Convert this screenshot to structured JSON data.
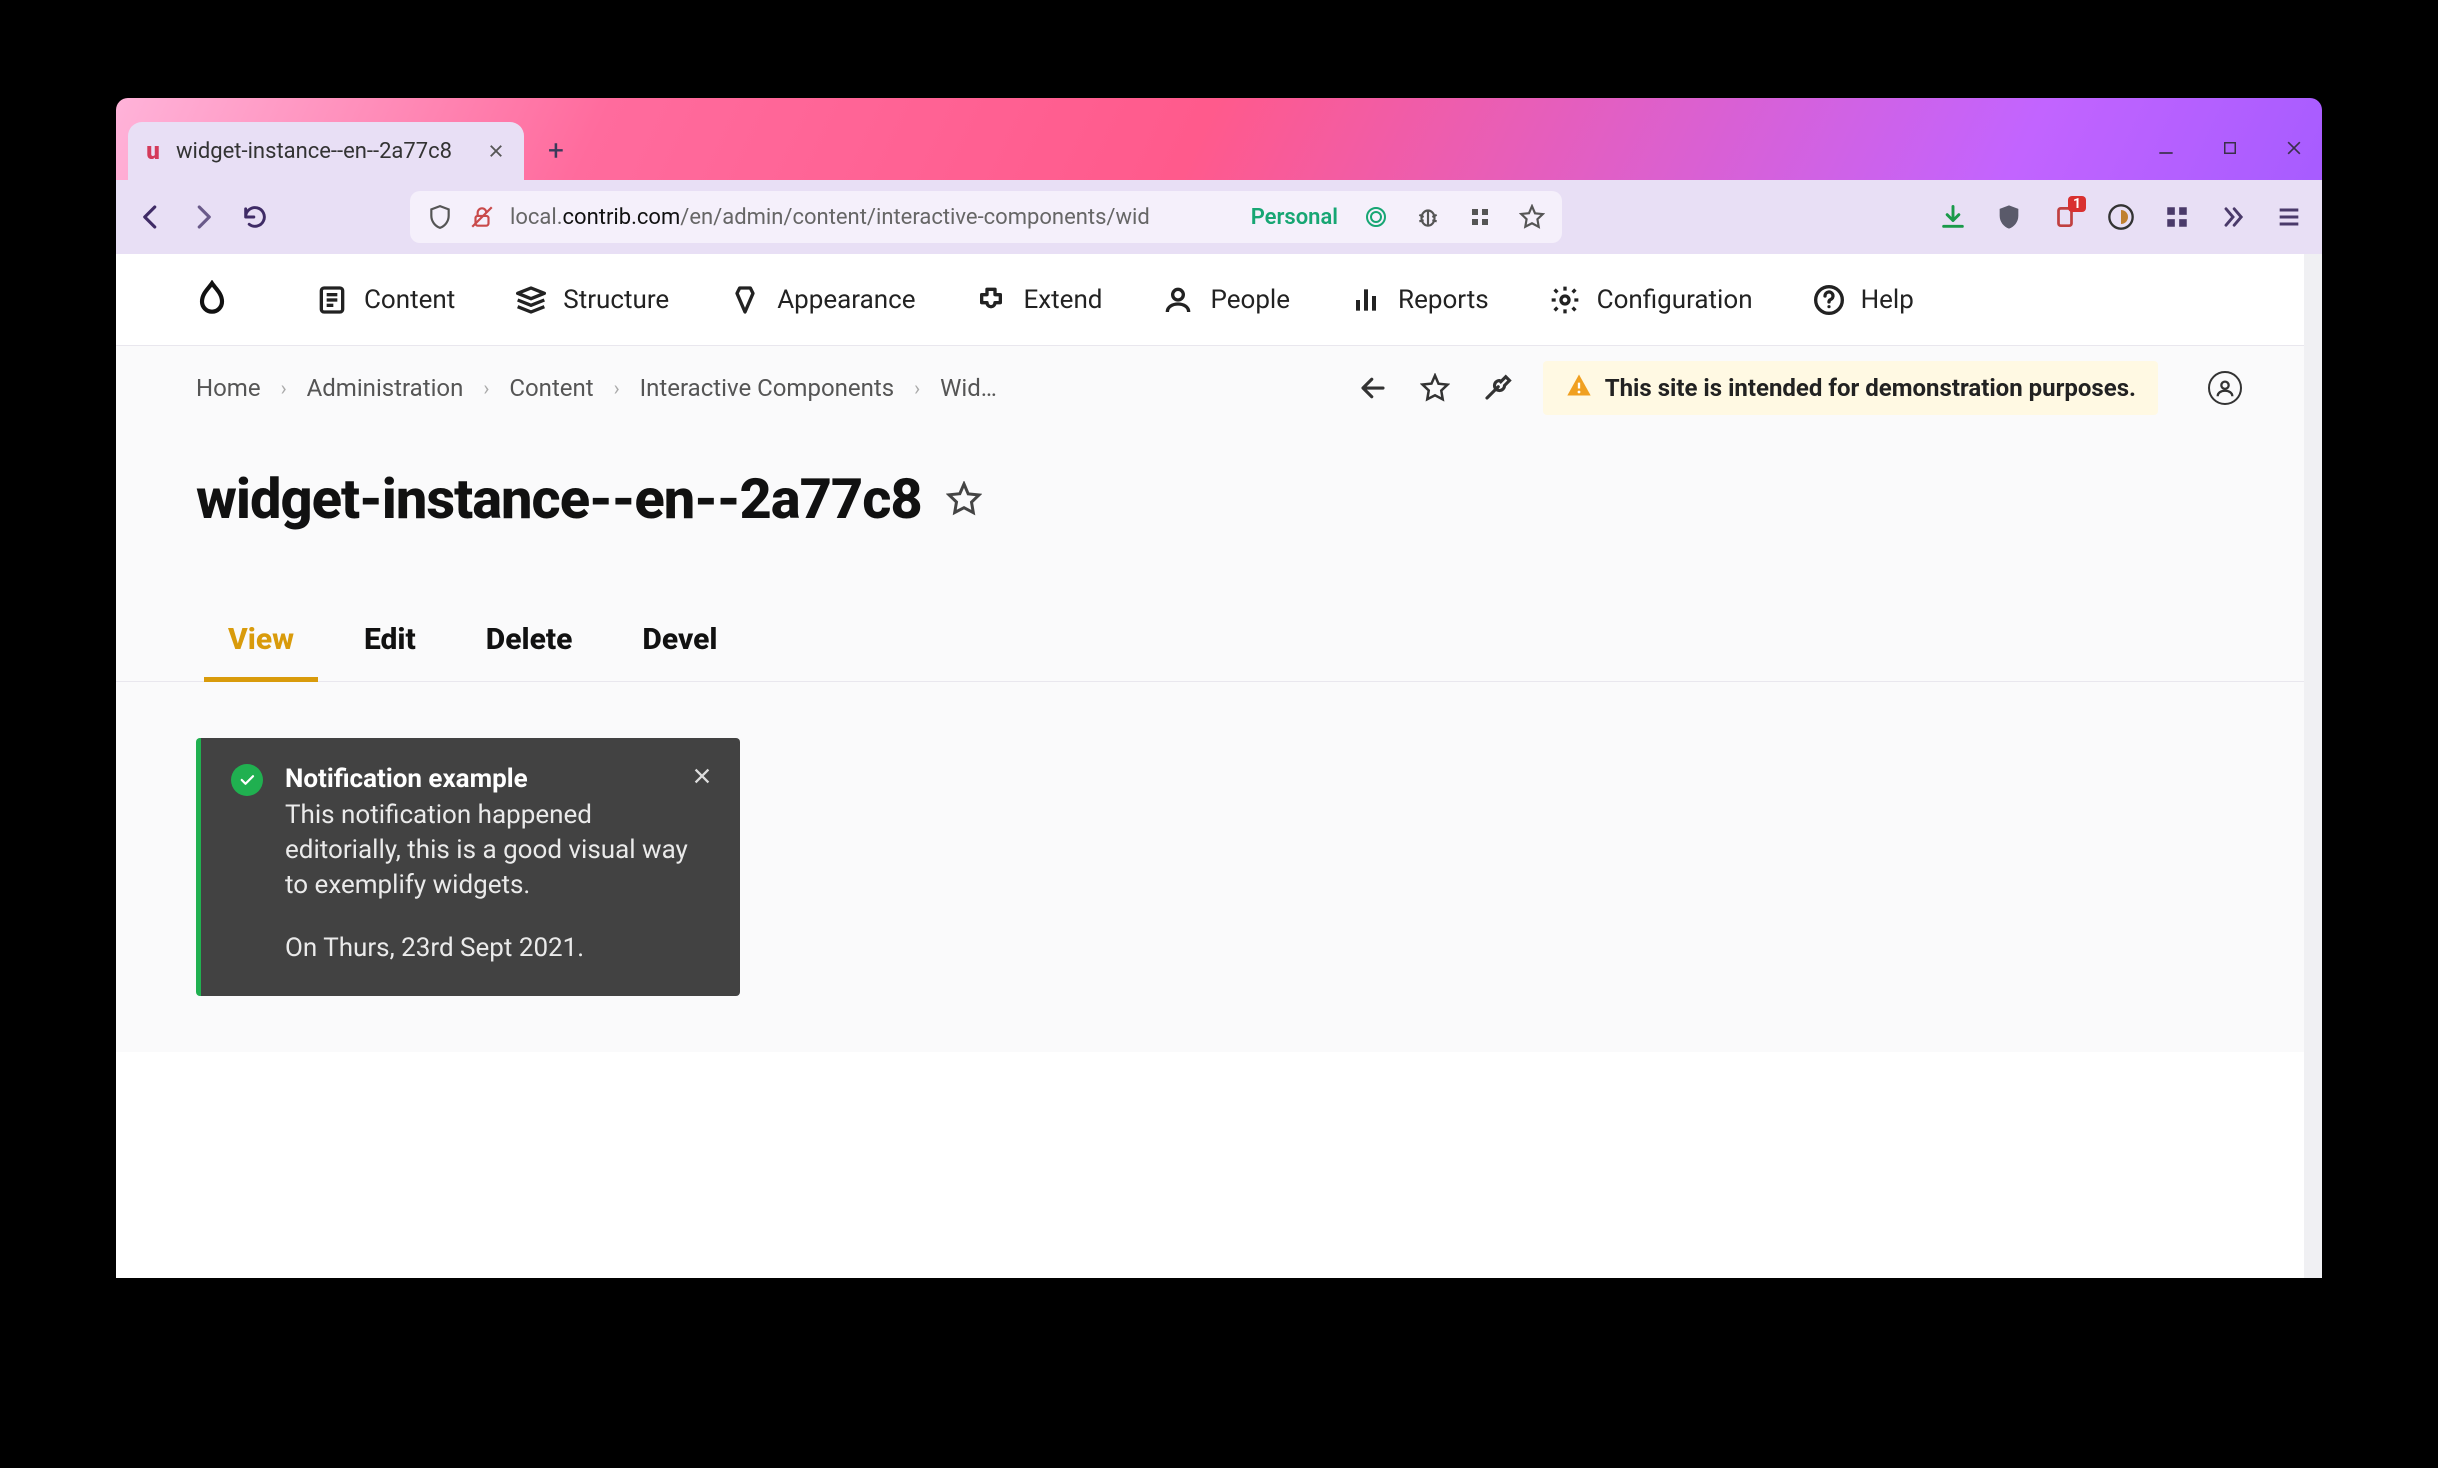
{
  "browser": {
    "tab_title": "widget-instance--en--2a77c8",
    "url_prefix": "local.",
    "url_domain": "contrib.com",
    "url_path": "/en/admin/content/interactive-components/wid",
    "personal_label": "Personal",
    "badge_count": "1"
  },
  "admin_menu": {
    "items": [
      {
        "label": "Content"
      },
      {
        "label": "Structure"
      },
      {
        "label": "Appearance"
      },
      {
        "label": "Extend"
      },
      {
        "label": "People"
      },
      {
        "label": "Reports"
      },
      {
        "label": "Configuration"
      },
      {
        "label": "Help"
      }
    ]
  },
  "breadcrumbs": {
    "items": [
      "Home",
      "Administration",
      "Content",
      "Interactive Components",
      "Wid…"
    ]
  },
  "demo_banner": "This site is intended for demonstration purposes.",
  "page": {
    "title": "widget-instance--en--2a77c8",
    "tabs": [
      "View",
      "Edit",
      "Delete",
      "Devel"
    ],
    "active_tab": "View"
  },
  "notification": {
    "title": "Notification example",
    "body": "This notification happened editorially, this is a good visual way to exemplify widgets.",
    "footer": "On Thurs, 23rd Sept 2021."
  }
}
